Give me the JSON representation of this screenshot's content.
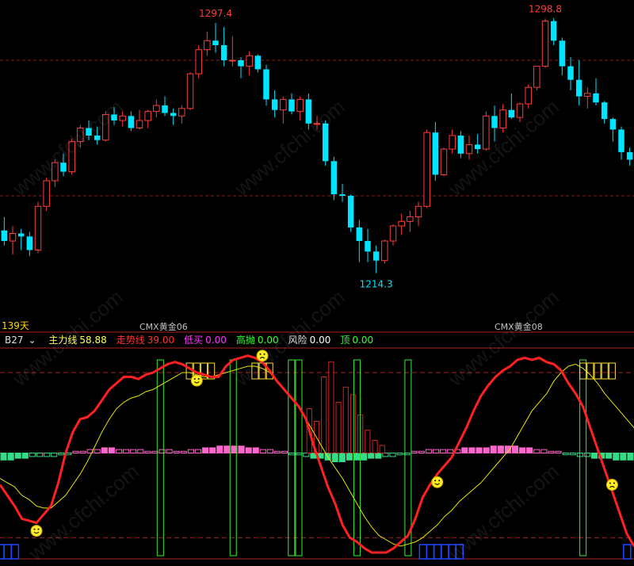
{
  "chart_data": [
    {
      "type": "candlestick",
      "instrument": "CMX黄金",
      "period_label": "139天",
      "contract_labels": [
        "CMX黄金06",
        "CMX黄金08"
      ],
      "annotations": [
        {
          "label": "1297.4",
          "value": 1297.4,
          "kind": "high"
        },
        {
          "label": "1214.3",
          "value": 1214.3,
          "kind": "low"
        },
        {
          "label": "1298.8",
          "value": 1298.8,
          "kind": "high"
        }
      ],
      "ylim": [
        1195,
        1305
      ],
      "colors": {
        "up": "#ff3c3c",
        "down": "#00e5ff",
        "grid": "#8a1a1a"
      },
      "candles": [
        [
          1228.5,
          1233.0,
          1223.5,
          1225.0
        ],
        [
          1225.0,
          1230.0,
          1220.5,
          1227.5
        ],
        [
          1227.5,
          1229.0,
          1222.0,
          1226.5
        ],
        [
          1226.5,
          1228.0,
          1220.0,
          1222.0
        ],
        [
          1222.0,
          1238.0,
          1221.0,
          1236.5
        ],
        [
          1236.5,
          1246.0,
          1235.0,
          1245.0
        ],
        [
          1245.0,
          1252.0,
          1243.0,
          1251.0
        ],
        [
          1251.0,
          1254.0,
          1246.5,
          1248.0
        ],
        [
          1248.0,
          1259.0,
          1247.0,
          1258.0
        ],
        [
          1258.0,
          1263.5,
          1256.0,
          1262.5
        ],
        [
          1262.5,
          1265.0,
          1258.5,
          1260.0
        ],
        [
          1260.0,
          1263.0,
          1257.0,
          1258.5
        ],
        [
          1258.5,
          1268.0,
          1258.0,
          1267.0
        ],
        [
          1267.0,
          1269.5,
          1263.5,
          1265.0
        ],
        [
          1265.0,
          1268.0,
          1263.0,
          1266.5
        ],
        [
          1266.5,
          1268.0,
          1261.5,
          1262.5
        ],
        [
          1262.5,
          1268.5,
          1262.0,
          1265.0
        ],
        [
          1265.0,
          1268.5,
          1262.5,
          1268.0
        ],
        [
          1268.0,
          1272.0,
          1266.0,
          1270.0
        ],
        [
          1270.0,
          1273.0,
          1266.5,
          1267.5
        ],
        [
          1267.5,
          1269.0,
          1263.5,
          1266.5
        ],
        [
          1266.5,
          1270.0,
          1264.0,
          1269.0
        ],
        [
          1269.0,
          1281.0,
          1268.5,
          1280.5
        ],
        [
          1280.5,
          1290.0,
          1279.0,
          1288.5
        ],
        [
          1288.5,
          1294.5,
          1286.5,
          1291.5
        ],
        [
          1291.5,
          1297.4,
          1287.5,
          1290.0
        ],
        [
          1290.0,
          1296.0,
          1283.0,
          1285.0
        ],
        [
          1285.0,
          1293.0,
          1283.0,
          1285.0
        ],
        [
          1285.0,
          1286.0,
          1279.0,
          1283.0
        ],
        [
          1283.0,
          1288.0,
          1280.0,
          1286.5
        ],
        [
          1286.5,
          1287.0,
          1281.0,
          1282.0
        ],
        [
          1282.0,
          1283.5,
          1270.0,
          1272.0
        ],
        [
          1272.0,
          1275.0,
          1266.0,
          1268.5
        ],
        [
          1268.5,
          1273.0,
          1264.0,
          1272.0
        ],
        [
          1272.0,
          1274.0,
          1267.0,
          1268.0
        ],
        [
          1268.0,
          1273.0,
          1265.0,
          1272.0
        ],
        [
          1272.0,
          1274.0,
          1262.0,
          1264.0
        ],
        [
          1264.0,
          1266.5,
          1262.0,
          1264.0
        ],
        [
          1264.0,
          1265.0,
          1250.0,
          1251.5
        ],
        [
          1251.5,
          1253.0,
          1238.5,
          1240.5
        ],
        [
          1240.5,
          1244.0,
          1238.0,
          1240.0
        ],
        [
          1240.0,
          1240.5,
          1228.0,
          1229.5
        ],
        [
          1229.5,
          1232.0,
          1218.0,
          1225.0
        ],
        [
          1225.0,
          1229.0,
          1218.0,
          1221.5
        ],
        [
          1221.5,
          1223.5,
          1214.3,
          1218.5
        ],
        [
          1218.5,
          1225.5,
          1217.5,
          1225.0
        ],
        [
          1225.0,
          1230.5,
          1223.5,
          1230.0
        ],
        [
          1230.0,
          1234.0,
          1227.0,
          1231.5
        ],
        [
          1231.5,
          1235.0,
          1228.0,
          1233.0
        ],
        [
          1233.0,
          1238.0,
          1230.0,
          1236.5
        ],
        [
          1236.5,
          1262.0,
          1236.0,
          1261.0
        ],
        [
          1261.0,
          1264.5,
          1245.0,
          1247.0
        ],
        [
          1247.0,
          1256.0,
          1246.5,
          1255.5
        ],
        [
          1255.5,
          1262.0,
          1254.0,
          1260.0
        ],
        [
          1260.0,
          1261.5,
          1252.5,
          1254.0
        ],
        [
          1254.0,
          1260.0,
          1252.0,
          1257.0
        ],
        [
          1257.0,
          1260.5,
          1254.0,
          1255.5
        ],
        [
          1255.5,
          1268.0,
          1255.0,
          1266.5
        ],
        [
          1266.5,
          1270.0,
          1258.0,
          1262.5
        ],
        [
          1262.5,
          1270.5,
          1261.0,
          1268.5
        ],
        [
          1268.5,
          1274.0,
          1265.5,
          1266.0
        ],
        [
          1266.0,
          1271.0,
          1264.5,
          1270.5
        ],
        [
          1270.5,
          1277.0,
          1269.0,
          1276.0
        ],
        [
          1276.0,
          1283.0,
          1275.0,
          1283.0
        ],
        [
          1283.0,
          1298.8,
          1282.5,
          1298.0
        ],
        [
          1298.0,
          1299.0,
          1290.0,
          1291.5
        ],
        [
          1291.5,
          1292.5,
          1280.0,
          1283.0
        ],
        [
          1283.0,
          1286.0,
          1275.0,
          1278.5
        ],
        [
          1278.5,
          1285.0,
          1270.0,
          1273.0
        ],
        [
          1273.0,
          1276.0,
          1269.0,
          1274.0
        ],
        [
          1274.0,
          1279.0,
          1270.0,
          1271.0
        ],
        [
          1271.0,
          1271.5,
          1264.0,
          1265.5
        ],
        [
          1265.5,
          1266.0,
          1258.0,
          1262.0
        ],
        [
          1262.0,
          1263.0,
          1252.0,
          1254.5
        ],
        [
          1254.5,
          1256.0,
          1250.0,
          1252.0
        ]
      ]
    },
    {
      "type": "indicator",
      "name": "B27",
      "legend": [
        {
          "label": "主力线",
          "value": "58.88",
          "color": "#ffff55"
        },
        {
          "label": "走势线",
          "value": "39.00",
          "color": "#ff3030"
        },
        {
          "label": "低买",
          "value": "0.00",
          "color": "#ff33ff"
        },
        {
          "label": "高抛",
          "value": "0.00",
          "color": "#33ff33"
        },
        {
          "label": "风险",
          "value": "0.00",
          "color": "#e0e0e0"
        },
        {
          "label": "顶",
          "value": "0.00",
          "color": "#33ff33"
        }
      ],
      "ylim": [
        0,
        100
      ],
      "reference_lines": [
        10,
        50,
        88
      ],
      "trend_line": [
        35,
        30,
        25,
        19,
        18,
        17,
        21,
        25,
        36,
        50,
        60,
        66,
        67,
        70,
        75,
        80,
        83,
        86,
        86,
        85,
        87,
        88,
        90,
        92,
        93,
        92,
        90,
        88,
        87,
        86,
        86,
        91,
        94,
        95,
        96,
        95,
        93,
        89,
        84,
        80,
        76,
        72,
        66,
        54,
        44,
        34,
        26,
        16,
        10,
        8,
        5,
        3,
        3,
        3,
        5,
        8,
        11,
        19,
        29,
        35,
        40,
        44,
        48,
        55,
        62,
        70,
        77,
        82,
        86,
        89,
        91,
        94,
        95,
        94,
        95,
        93,
        92,
        89,
        83,
        78,
        72,
        62,
        52,
        42,
        32,
        22,
        12,
        6
      ],
      "main_line": [
        38,
        36,
        34,
        30,
        28,
        25,
        24,
        24,
        27,
        30,
        35,
        40,
        46,
        53,
        60,
        66,
        71,
        74,
        76,
        77,
        79,
        80,
        82,
        84,
        86,
        88,
        88,
        87,
        86,
        86,
        87,
        88,
        89,
        90,
        91,
        91,
        90,
        88,
        84,
        80,
        76,
        72,
        66,
        60,
        54,
        48,
        43,
        38,
        32,
        26,
        20,
        15,
        11,
        9,
        7,
        6,
        7,
        8,
        10,
        13,
        16,
        20,
        23,
        27,
        30,
        33,
        36,
        40,
        44,
        48,
        52,
        58,
        64,
        70,
        74,
        78,
        84,
        88,
        91,
        92,
        90,
        87,
        83,
        78,
        74,
        70,
        66,
        62,
        58
      ],
      "histogram": [
        -4,
        -4,
        -3,
        -3,
        -2,
        -2,
        -2,
        -2,
        -1,
        -1,
        1,
        1,
        2,
        2,
        3,
        3,
        2,
        2,
        2,
        2,
        1,
        1,
        2,
        2,
        1,
        1,
        2,
        2,
        3,
        3,
        4,
        4,
        4,
        4,
        3,
        3,
        2,
        2,
        1,
        1,
        -1,
        -1,
        -2,
        -3,
        -3,
        -4,
        -5,
        -5,
        -4,
        -4,
        -4,
        -3,
        -3,
        -2,
        -2,
        -1,
        -1,
        1,
        1,
        2,
        2,
        2,
        2,
        2,
        3,
        3,
        3,
        3,
        4,
        4,
        4,
        4,
        3,
        3,
        2,
        2,
        1,
        1,
        -1,
        -1,
        -2,
        -2,
        -3,
        -3,
        -3,
        -4,
        -4,
        -4
      ],
      "sell_signal_bars": [
        35,
        25,
        60,
        72,
        40,
        52,
        46,
        30,
        18,
        10,
        6
      ],
      "buy_zone_bars": [
        0,
        1,
        2,
        58,
        59,
        60,
        61,
        62,
        63,
        86
      ],
      "high_zone_columns": [
        22,
        32,
        40,
        41,
        49,
        56,
        80
      ],
      "smile_faces": [
        5,
        27,
        60
      ],
      "frown_faces": [
        36,
        84
      ]
    }
  ]
}
